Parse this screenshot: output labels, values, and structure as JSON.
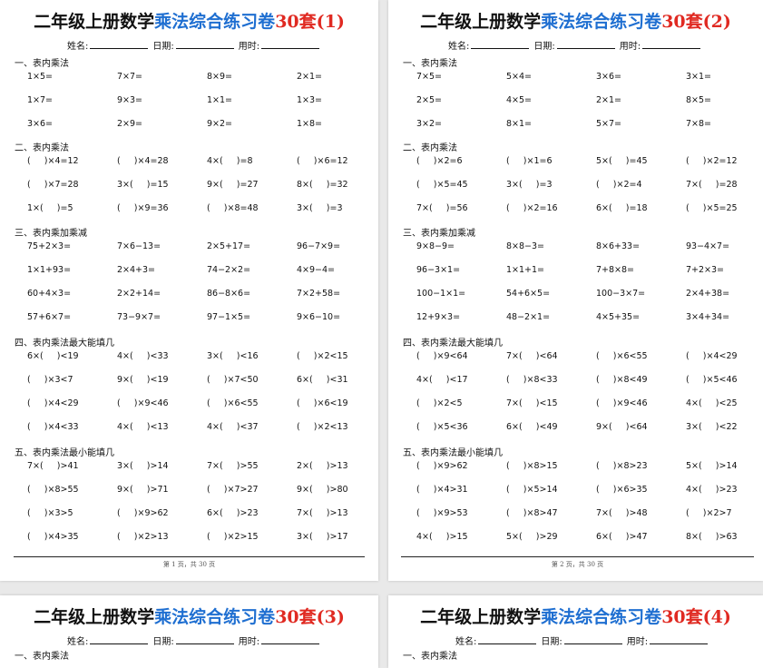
{
  "pages": [
    {
      "title": {
        "part1": "二年级上册数学",
        "part2": "乘法综合练习卷",
        "part3": "30套(1)"
      },
      "info": {
        "name_label": "姓名:",
        "date_label": "日期:",
        "time_label": "用时:"
      },
      "footer": "第 1 页，共 30 页",
      "sections": [
        {
          "title": "一、表内乘法",
          "rows": [
            [
              "1×5=",
              "7×7=",
              "8×9=",
              "2×1="
            ],
            [
              "1×7=",
              "9×3=",
              "1×1=",
              "1×3="
            ],
            [
              "3×6=",
              "2×9=",
              "9×2=",
              "1×8="
            ]
          ]
        },
        {
          "title": "二、表内乘法",
          "rows": [
            [
              "(     )×4=12",
              "(     )×4=28",
              "4×(     )=8",
              "(     )×6=12"
            ],
            [
              "(     )×7=28",
              "3×(     )=15",
              "9×(     )=27",
              "8×(     )=32"
            ],
            [
              "1×(     )=5",
              "(     )×9=36",
              "(     )×8=48",
              "3×(     )=3"
            ]
          ]
        },
        {
          "title": "三、表内乘加乘减",
          "rows": [
            [
              "75+2×3=",
              "7×6−13=",
              "2×5+17=",
              "96−7×9="
            ],
            [
              "1×1+93=",
              "2×4+3=",
              "74−2×2=",
              "4×9−4="
            ],
            [
              "60+4×3=",
              "2×2+14=",
              "86−8×6=",
              "7×2+58="
            ],
            [
              "57+6×7=",
              "73−9×7=",
              "97−1×5=",
              "9×6−10="
            ]
          ]
        },
        {
          "title": "四、表内乘法最大能填几",
          "rows": [
            [
              "6×(     )<19",
              "4×(     )<33",
              "3×(     )<16",
              "(     )×2<15"
            ],
            [
              "(     )×3<7",
              "9×(     )<19",
              "(     )×7<50",
              "6×(     )<31"
            ],
            [
              "(     )×4<29",
              "(     )×9<46",
              "(     )×6<55",
              "(     )×6<19"
            ],
            [
              "(     )×4<33",
              "4×(     )<13",
              "4×(     )<37",
              "(     )×2<13"
            ]
          ]
        },
        {
          "title": "五、表内乘法最小能填几",
          "rows": [
            [
              "7×(     )>41",
              "3×(     )>14",
              "7×(     )>55",
              "2×(     )>13"
            ],
            [
              "(     )×8>55",
              "9×(     )>71",
              "(     )×7>27",
              "9×(     )>80"
            ],
            [
              "(     )×3>5",
              "(     )×9>62",
              "6×(     )>23",
              "7×(     )>13"
            ],
            [
              "(     )×4>35",
              "(     )×2>13",
              "(     )×2>15",
              "3×(     )>17"
            ]
          ]
        }
      ]
    },
    {
      "title": {
        "part1": "二年级上册数学",
        "part2": "乘法综合练习卷",
        "part3": "30套(2)"
      },
      "info": {
        "name_label": "姓名:",
        "date_label": "日期:",
        "time_label": "用时:"
      },
      "footer": "第 2 页，共 30 页",
      "sections": [
        {
          "title": "一、表内乘法",
          "rows": [
            [
              "7×5=",
              "5×4=",
              "3×6=",
              "3×1="
            ],
            [
              "2×5=",
              "4×5=",
              "2×1=",
              "8×5="
            ],
            [
              "3×2=",
              "8×1=",
              "5×7=",
              "7×8="
            ]
          ]
        },
        {
          "title": "二、表内乘法",
          "rows": [
            [
              "(     )×2=6",
              "(     )×1=6",
              "5×(     )=45",
              "(     )×2=12"
            ],
            [
              "(     )×5=45",
              "3×(     )=3",
              "(     )×2=4",
              "7×(     )=28"
            ],
            [
              "7×(     )=56",
              "(     )×2=16",
              "6×(     )=18",
              "(     )×5=25"
            ]
          ]
        },
        {
          "title": "三、表内乘加乘减",
          "rows": [
            [
              "9×8−9=",
              "8×8−3=",
              "8×6+33=",
              "93−4×7="
            ],
            [
              "96−3×1=",
              "1×1+1=",
              "7+8×8=",
              "7+2×3="
            ],
            [
              "100−1×1=",
              "54+6×5=",
              "100−3×7=",
              "2×4+38="
            ],
            [
              "12+9×3=",
              "48−2×1=",
              "4×5+35=",
              "3×4+34="
            ]
          ]
        },
        {
          "title": "四、表内乘法最大能填几",
          "rows": [
            [
              "(     )×9<64",
              "7×(     )<64",
              "(     )×6<55",
              "(     )×4<29"
            ],
            [
              "4×(     )<17",
              "(     )×8<33",
              "(     )×8<49",
              "(     )×5<46"
            ],
            [
              "(     )×2<5",
              "7×(     )<15",
              "(     )×9<46",
              "4×(     )<25"
            ],
            [
              "(     )×5<36",
              "6×(     )<49",
              "9×(     )<64",
              "3×(     )<22"
            ]
          ]
        },
        {
          "title": "五、表内乘法最小能填几",
          "rows": [
            [
              "(     )×9>62",
              "(     )×8>15",
              "(     )×8>23",
              "5×(     )>14"
            ],
            [
              "(     )×4>31",
              "(     )×5>14",
              "(     )×6>35",
              "4×(     )>23"
            ],
            [
              "(     )×9>53",
              "(     )×8>47",
              "7×(     )>48",
              "(     )×2>7"
            ],
            [
              "4×(     )>15",
              "5×(     )>29",
              "6×(     )>47",
              "8×(     )>63"
            ]
          ]
        }
      ]
    },
    {
      "title": {
        "part1": "二年级上册数学",
        "part2": "乘法综合练习卷",
        "part3": "30套(3)"
      },
      "info": {
        "name_label": "姓名:",
        "date_label": "日期:",
        "time_label": "用时:"
      },
      "sections": [
        {
          "title": "一、表内乘法"
        }
      ]
    },
    {
      "title": {
        "part1": "二年级上册数学",
        "part2": "乘法综合练习卷",
        "part3": "30套(4)"
      },
      "info": {
        "name_label": "姓名:",
        "date_label": "日期:",
        "time_label": "用时:"
      },
      "sections": [
        {
          "title": "一、表内乘法"
        }
      ]
    }
  ]
}
